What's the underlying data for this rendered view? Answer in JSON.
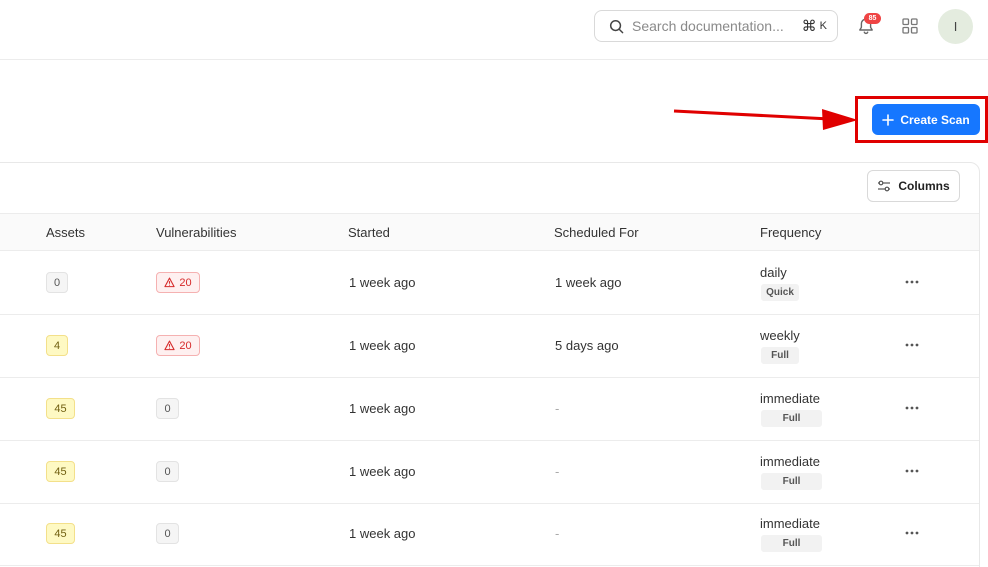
{
  "header": {
    "search_placeholder": "Search documentation...",
    "shortcut_cmd": "⌘",
    "shortcut_key": "K",
    "notification_count": "85",
    "avatar_initial": "I"
  },
  "actions": {
    "create_label": "Create Scan",
    "columns_label": "Columns"
  },
  "colors": {
    "primary": "#1677ff",
    "highlight": "#e00000",
    "badge": "#ef4444"
  },
  "table": {
    "headers": {
      "assets": "Assets",
      "vulnerabilities": "Vulnerabilities",
      "started": "Started",
      "scheduled_for": "Scheduled For",
      "frequency": "Frequency"
    },
    "rows": [
      {
        "assets": "0",
        "vulnerabilities": "20",
        "started": "1 week ago",
        "scheduled_for": "1 week ago",
        "frequency": "daily",
        "type": "Quick"
      },
      {
        "assets": "4",
        "vulnerabilities": "20",
        "started": "1 week ago",
        "scheduled_for": "5 days ago",
        "frequency": "weekly",
        "type": "Full"
      },
      {
        "assets": "45",
        "vulnerabilities": "0",
        "started": "1 week ago",
        "scheduled_for": "-",
        "frequency": "immediate",
        "type": "Full"
      },
      {
        "assets": "45",
        "vulnerabilities": "0",
        "started": "1 week ago",
        "scheduled_for": "-",
        "frequency": "immediate",
        "type": "Full"
      },
      {
        "assets": "45",
        "vulnerabilities": "0",
        "started": "1 week ago",
        "scheduled_for": "-",
        "frequency": "immediate",
        "type": "Full"
      }
    ]
  }
}
